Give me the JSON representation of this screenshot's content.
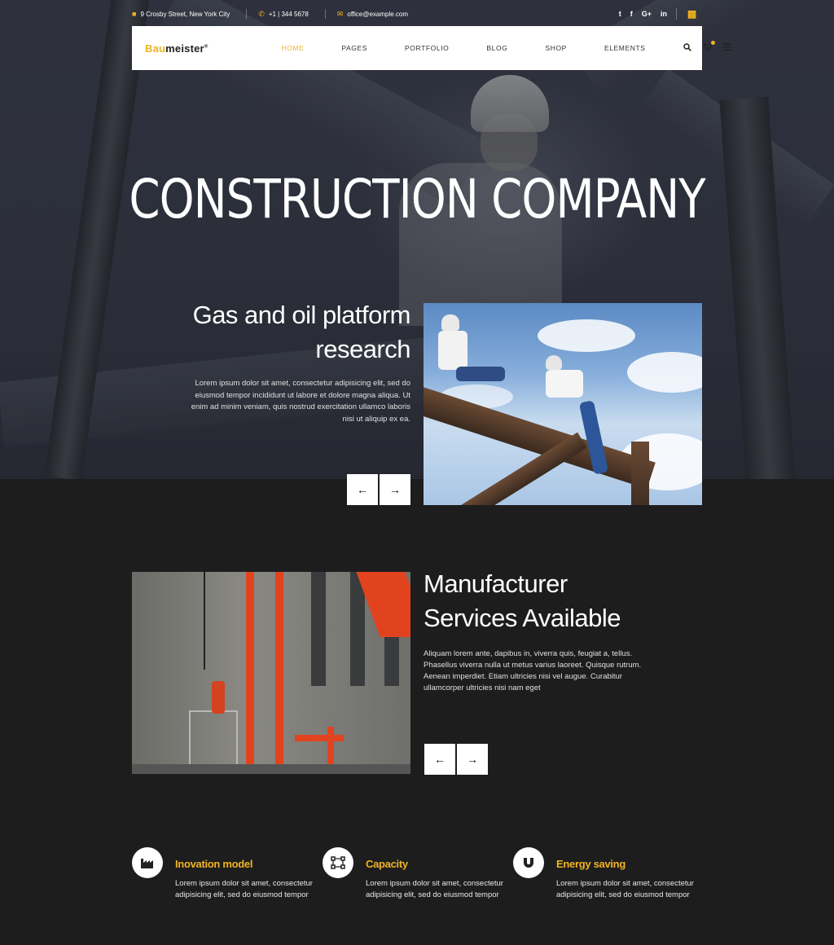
{
  "topbar": {
    "address": "9 Crosby Street, New York City",
    "phone": "+1 | 344 5678",
    "email": "office@example.com",
    "social": [
      "twitter-icon",
      "facebook-icon",
      "google-plus-icon",
      "linkedin-icon"
    ],
    "social_labels": {
      "twitter": "t",
      "facebook": "f",
      "google": "G+",
      "linkedin": "in"
    }
  },
  "nav": {
    "logo_accent": "Bau",
    "logo_rest": "meister",
    "logo_mark": "®",
    "items": [
      {
        "label": "HOME",
        "active": true
      },
      {
        "label": "PAGES",
        "active": false
      },
      {
        "label": "PORTFOLIO",
        "active": false
      },
      {
        "label": "BLOG",
        "active": false
      },
      {
        "label": "SHOP",
        "active": false
      },
      {
        "label": "ELEMENTS",
        "active": false
      }
    ]
  },
  "hero": {
    "title": "CONSTRUCTION COMPANY"
  },
  "slide1": {
    "title_line1": "Gas and oil platform",
    "title_line2": "research",
    "text": "Lorem ipsum dolor sit amet, consectetur adipisicing elit, sed do eiusmod tempor incididunt ut labore et dolore magna aliqua. Ut enim ad minim veniam, quis nostrud exercitation ullamco laboris nisi ut aliquip ex ea."
  },
  "slide2": {
    "title_line1": "Manufacturer",
    "title_line2": "Services Available",
    "text": "Aliquam lorem ante, dapibus in, viverra quis, feugiat a, tellus. Phasellus viverra nulla ut metus varius laoreet. Quisque rutrum. Aenean imperdiet. Etiam ultricies nisi vel augue. Curabitur ullamcorper ultricies nisi nam eget"
  },
  "arrows": {
    "prev": "←",
    "next": "→"
  },
  "features": [
    {
      "icon": "factory-icon",
      "title": "Inovation model",
      "text": "Lorem ipsum dolor sit amet, consectetur adipisicing elit, sed do eiusmod tempor"
    },
    {
      "icon": "network-icon",
      "title": "Capacity",
      "text": "Lorem ipsum dolor sit amet, consectetur adipisicing elit, sed do eiusmod tempor"
    },
    {
      "icon": "magnet-icon",
      "title": "Energy saving",
      "text": "Lorem ipsum dolor sit amet, consectetur adipisicing elit, sed do eiusmod tempor"
    }
  ],
  "colors": {
    "accent": "#f0b323",
    "background": "#1d1d1d",
    "nav_bg": "#ffffff"
  }
}
